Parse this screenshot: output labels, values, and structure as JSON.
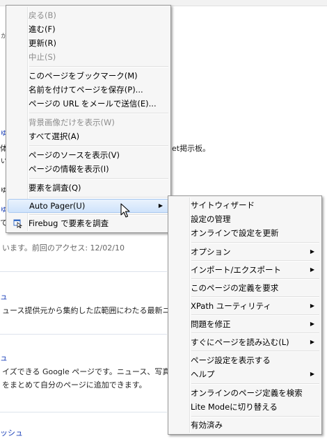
{
  "background_page": {
    "fragments": {
      "f1": "ゅ",
      "f2": "体",
      "f3": "ぃ",
      "f4": "ゅ",
      "f5": "ゅ",
      "f6": "て",
      "line_visit": "います。前回のアクセス: 12/02/10",
      "line_board": "et掲示板。",
      "link_a": "ュ",
      "line_news": "ュース提供元から集約した広範囲にわたる最新ニ",
      "link_b": "ュ",
      "line_google": "イズできる Google ページです。ニュース、写真",
      "line_google2": "をまとめて自分のページに追加できます。",
      "link_c": "ッシュ",
      "partial_top": "ゕ"
    }
  },
  "context_menu": {
    "items": [
      {
        "label": "戻る(B)",
        "disabled": true
      },
      {
        "label": "進む(F)",
        "disabled": false
      },
      {
        "label": "更新(R)",
        "disabled": false
      },
      {
        "label": "中止(S)",
        "disabled": true
      },
      {
        "label": "このページをブックマーク(M)",
        "disabled": false
      },
      {
        "label": "名前を付けてページを保存(P)...",
        "disabled": false
      },
      {
        "label": "ページの URL をメールで送信(E)...",
        "disabled": false
      },
      {
        "label": "背景画像だけを表示(W)",
        "disabled": true
      },
      {
        "label": "すべて選択(A)",
        "disabled": false
      },
      {
        "label": "ページのソースを表示(V)",
        "disabled": false
      },
      {
        "label": "ページの情報を表示(I)",
        "disabled": false
      },
      {
        "label": "要素を調査(Q)",
        "disabled": false
      },
      {
        "label": "Auto Pager(U)",
        "disabled": false,
        "submenu": true,
        "highlighted": true
      },
      {
        "label": "Firebug で要素を調査",
        "disabled": false,
        "icon": "firebug-icon"
      }
    ]
  },
  "submenu": {
    "items": [
      {
        "label": "サイトウィザード"
      },
      {
        "label": "設定の管理"
      },
      {
        "label": "オンラインで設定を更新"
      },
      {
        "label": "オプション",
        "submenu": true
      },
      {
        "label": "インポート/エクスポート",
        "submenu": true
      },
      {
        "label": "このページの定義を要求"
      },
      {
        "label": "XPath ユーティリティ",
        "submenu": true
      },
      {
        "label": "問題を修正",
        "submenu": true
      },
      {
        "label": "すぐにページを読み込む(L)",
        "submenu": true
      },
      {
        "label": "ページ設定を表示する"
      },
      {
        "label": "ヘルプ",
        "submenu": true
      },
      {
        "label": "オンラインのページ定義を検索"
      },
      {
        "label": "Lite Modeに切り替える"
      },
      {
        "label": "有効済み"
      }
    ]
  },
  "icons": {
    "submenu_arrow": "▶"
  },
  "colors": {
    "highlight": "#cfe3fb",
    "menu_bg": "#f6f6f6",
    "link": "#1a3fb8"
  }
}
